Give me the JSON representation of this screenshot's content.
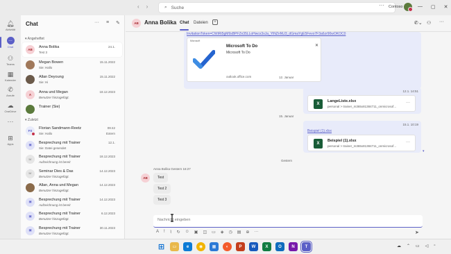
{
  "titlebar": {
    "search_placeholder": "Suche",
    "org": "Contoso",
    "more": "···"
  },
  "rail": [
    {
      "label": "Aktivität",
      "icon": "bell-icon"
    },
    {
      "label": "Chat",
      "icon": "chat-icon"
    },
    {
      "label": "Teams",
      "icon": "teams-icon"
    },
    {
      "label": "Kalender",
      "icon": "calendar-icon"
    },
    {
      "label": "Anrufe",
      "icon": "phone-icon"
    },
    {
      "label": "OneDrive",
      "icon": "cloud-icon"
    },
    {
      "label": "···",
      "icon": "more-icon"
    },
    {
      "label": "Apps",
      "icon": "apps-icon"
    }
  ],
  "chatlist": {
    "title": "Chat",
    "pinned_label": "Angeheftet",
    "recent_label": "Zuletzt",
    "pinned": [
      {
        "name": "Anna Bolika",
        "sub": "Test 3",
        "date": "24.1.",
        "initials": "AB",
        "bg": "#f6d1d5",
        "fg": "#a4262c",
        "italic": false
      },
      {
        "name": "Megan Bowen",
        "sub": "Sie: Hallo",
        "date": "15.11.2022",
        "initials": "",
        "bg": "#a0785a",
        "fg": "#fff",
        "italic": false
      },
      {
        "name": "Allan Deyoung",
        "sub": "Sie: Hi",
        "date": "15.11.2022",
        "initials": "",
        "bg": "#6b5a4a",
        "fg": "#fff",
        "italic": false
      },
      {
        "name": "Anna und Megan",
        "sub": "Benutzer hinzugefügt.",
        "date": "18.12.2023",
        "initials": "A",
        "bg": "#f6d1d5",
        "fg": "#a4262c",
        "italic": true
      },
      {
        "name": "Trainer (Sie)",
        "sub": "",
        "date": "",
        "initials": "",
        "bg": "#5b7a3c",
        "fg": "#fff",
        "italic": false
      }
    ],
    "recent": [
      {
        "name": "Florian Sandmann-Reetz",
        "sub": "Sie: Hallo",
        "date": "09:42",
        "date2": "Extern",
        "initials": "FS",
        "bg": "#e8ebfa",
        "fg": "#5b5fc7",
        "italic": false
      },
      {
        "name": "Besprechung mit Trainer",
        "sub": "Sie: Datei gesendet",
        "date": "12.1.",
        "date2": "",
        "initials": "▣",
        "bg": "#dfe1f8",
        "fg": "#5b5fc7",
        "italic": false
      },
      {
        "name": "Besprechung mit Trainer",
        "sub": "Aufzeichnung ist bereit",
        "date": "18.12.2023",
        "date2": "",
        "initials": "☏",
        "bg": "#e6e6e6",
        "fg": "#616161",
        "italic": true
      },
      {
        "name": "Seminar Dies & Das",
        "sub": "Benutzer hinzugefügt.",
        "date": "14.12.2023",
        "date2": "",
        "initials": "☏",
        "bg": "#e6e6e6",
        "fg": "#616161",
        "italic": true
      },
      {
        "name": "Allan, Anna und Megan",
        "sub": "Benutzer hinzugefügt.",
        "date": "14.12.2023",
        "date2": "",
        "initials": "",
        "bg": "#8a6a4a",
        "fg": "#fff",
        "italic": true
      },
      {
        "name": "Besprechung mit Trainer",
        "sub": "Aufzeichnung ist bereit",
        "date": "14.12.2023",
        "date2": "",
        "initials": "▣",
        "bg": "#dfe1f8",
        "fg": "#5b5fc7",
        "italic": true
      },
      {
        "name": "Besprechung mit Trainer",
        "sub": "Benutzer hinzugefügt.",
        "date": "6.12.2023",
        "date2": "",
        "initials": "▣",
        "bg": "#dfe1f8",
        "fg": "#5b5fc7",
        "italic": true
      },
      {
        "name": "Besprechung mit Trainer",
        "sub": "Benutzer hinzugefügt.",
        "date": "30.11.2023",
        "date2": "",
        "initials": "▣",
        "bg": "#dfe1f8",
        "fg": "#5b5fc7",
        "italic": true
      }
    ]
  },
  "main": {
    "contact_initials": "AB",
    "contact_name": "Anna Bolika",
    "tab_chat": "Chat",
    "tab_files": "Dateien",
    "invite_link": "InvitationToken=CWiRt5gM9sBPFZn35LLoHwcx3sJa_YlNZnNU3_dGmaYgE5Fevo7F3a6zr90wOKOC0",
    "todo_title": "Microsoft To Do",
    "todo_sub": "Microsoft To Do",
    "todo_domain": "outlook.office.com",
    "todo_source": "Microsoft",
    "day1": "12. Januar",
    "msg1_time": "12.1. 14:51",
    "file1_name": "LangeListe.xlsx",
    "file1_path": "personal > trainer_m365x81384711_onmicrosof...",
    "day2": "15. Januar",
    "msg2_time": "15.1. 10:19",
    "msg2_link": "Beispiel (1).xlsx",
    "file2_name": "Beispiel (1).xlsx",
    "file2_path": "personal > trainer_m365x81384711_onmicrosof...",
    "day3": "Gestern",
    "in_meta": "Anna Bolika  Gestern 16:27",
    "in_msgs": [
      "Test",
      "Test 2",
      "Test 3"
    ],
    "compose_placeholder": "Nachricht eingeben"
  }
}
